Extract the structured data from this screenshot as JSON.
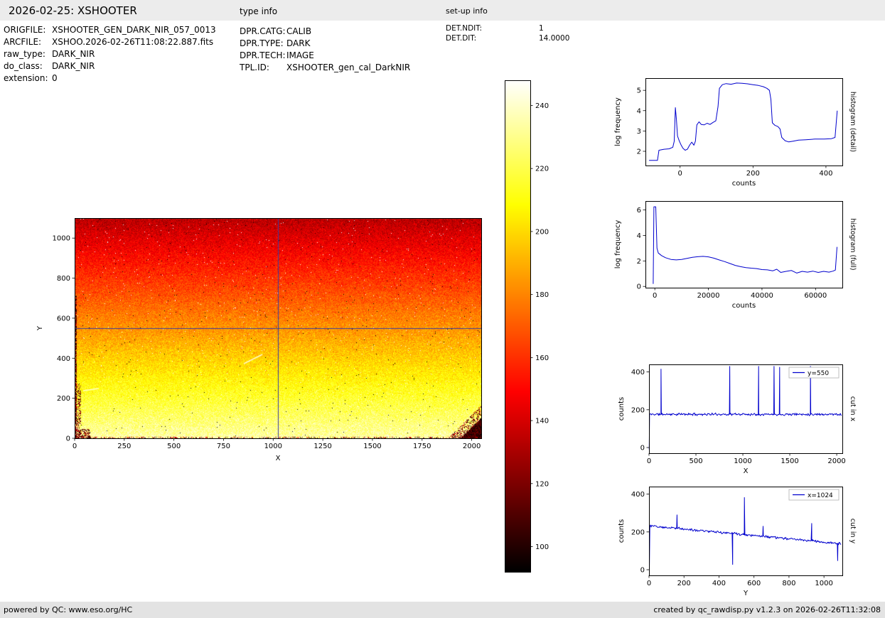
{
  "header": {
    "title": "2026-02-25: XSHOOTER",
    "type_info_label": "type info",
    "setup_info_label": "set-up info"
  },
  "file_info": {
    "rows": [
      {
        "label": "ORIGFILE:",
        "value": "XSHOOTER_GEN_DARK_NIR_057_0013"
      },
      {
        "label": "ARCFILE:",
        "value": "XSHOO.2026-02-26T11:08:22.887.fits"
      },
      {
        "label": "raw_type:",
        "value": "DARK_NIR"
      },
      {
        "label": "do_class:",
        "value": "DARK_NIR"
      },
      {
        "label": "extension:",
        "value": "0"
      }
    ]
  },
  "type_info": {
    "rows": [
      {
        "label": "DPR.CATG:",
        "value": "CALIB"
      },
      {
        "label": "DPR.TYPE:",
        "value": "DARK"
      },
      {
        "label": "DPR.TECH:",
        "value": "IMAGE"
      },
      {
        "label": "TPL.ID:",
        "value": "XSHOOTER_gen_cal_DarkNIR"
      }
    ]
  },
  "setup_info": {
    "rows": [
      {
        "label": "DET.NDIT:",
        "value": "1"
      },
      {
        "label": "DET.DIT:",
        "value": "14.0000"
      }
    ]
  },
  "footer": {
    "left": "powered by QC: www.eso.org/HC",
    "right": "created by qc_rawdisp.py v1.2.3 on 2026-02-26T11:32:08"
  },
  "style": {
    "line_color": "#0000cd",
    "crosshair_color": "#3a3a9e",
    "axis_color": "#000000",
    "colormap": "hot"
  },
  "chart_data": [
    {
      "id": "raw_image",
      "type": "heatmap",
      "xlabel": "X",
      "ylabel": "Y",
      "xlim": [
        0,
        2048
      ],
      "ylim": [
        0,
        1100
      ],
      "xticks": [
        0,
        250,
        500,
        750,
        1000,
        1250,
        1500,
        1750,
        2000
      ],
      "yticks": [
        0,
        200,
        400,
        600,
        800,
        1000
      ],
      "vmin": 92,
      "vmax": 248,
      "value_top": 133,
      "value_bottom": 234,
      "noise_sigma": 7,
      "crosshair": {
        "x": 1024,
        "y": 550
      },
      "colorbar": {
        "ticks": [
          100,
          120,
          140,
          160,
          180,
          200,
          220,
          240
        ]
      },
      "ylabel_off": 46,
      "xlabel_off": 31
    },
    {
      "id": "hist_detail",
      "type": "line",
      "right_label": "histogram (detail)",
      "xlabel": "counts",
      "ylabel": "log frequency",
      "xlim": [
        -95,
        445
      ],
      "ylim": [
        1.3,
        5.6
      ],
      "xticks": [
        0,
        200,
        400
      ],
      "yticks": [
        2,
        3,
        4,
        5
      ],
      "points": [
        [
          -85,
          1.55
        ],
        [
          -62,
          1.55
        ],
        [
          -58,
          2.05
        ],
        [
          -44,
          2.1
        ],
        [
          -30,
          2.12
        ],
        [
          -20,
          2.2
        ],
        [
          -16,
          2.5
        ],
        [
          -13,
          4.15
        ],
        [
          -10,
          3.55
        ],
        [
          -7,
          2.75
        ],
        [
          -2,
          2.5
        ],
        [
          3,
          2.3
        ],
        [
          8,
          2.15
        ],
        [
          14,
          2.05
        ],
        [
          20,
          2.1
        ],
        [
          26,
          2.3
        ],
        [
          32,
          2.45
        ],
        [
          38,
          2.3
        ],
        [
          42,
          2.5
        ],
        [
          46,
          3.3
        ],
        [
          52,
          3.45
        ],
        [
          58,
          3.32
        ],
        [
          66,
          3.3
        ],
        [
          74,
          3.38
        ],
        [
          82,
          3.32
        ],
        [
          90,
          3.42
        ],
        [
          98,
          3.5
        ],
        [
          104,
          4.2
        ],
        [
          108,
          5.1
        ],
        [
          116,
          5.28
        ],
        [
          126,
          5.33
        ],
        [
          140,
          5.3
        ],
        [
          155,
          5.36
        ],
        [
          170,
          5.35
        ],
        [
          185,
          5.32
        ],
        [
          200,
          5.28
        ],
        [
          215,
          5.24
        ],
        [
          228,
          5.18
        ],
        [
          238,
          5.1
        ],
        [
          245,
          5.0
        ],
        [
          249,
          4.55
        ],
        [
          253,
          3.4
        ],
        [
          260,
          3.28
        ],
        [
          268,
          3.22
        ],
        [
          274,
          3.1
        ],
        [
          279,
          2.68
        ],
        [
          288,
          2.52
        ],
        [
          298,
          2.46
        ],
        [
          310,
          2.5
        ],
        [
          325,
          2.55
        ],
        [
          345,
          2.57
        ],
        [
          370,
          2.6
        ],
        [
          395,
          2.6
        ],
        [
          415,
          2.62
        ],
        [
          425,
          2.68
        ],
        [
          431,
          4.0
        ]
      ]
    },
    {
      "id": "hist_full",
      "type": "line",
      "right_label": "histogram (full)",
      "xlabel": "counts",
      "ylabel": "log frequency",
      "xlim": [
        -3500,
        70000
      ],
      "ylim": [
        -0.1,
        6.7
      ],
      "xticks": [
        0,
        20000,
        40000,
        60000
      ],
      "yticks": [
        0,
        2,
        4,
        6
      ],
      "points": [
        [
          -600,
          0.2
        ],
        [
          -350,
          6.25
        ],
        [
          350,
          6.25
        ],
        [
          800,
          3.0
        ],
        [
          1300,
          2.62
        ],
        [
          2500,
          2.42
        ],
        [
          4000,
          2.25
        ],
        [
          6000,
          2.12
        ],
        [
          8000,
          2.08
        ],
        [
          10000,
          2.12
        ],
        [
          12000,
          2.2
        ],
        [
          14000,
          2.28
        ],
        [
          16000,
          2.33
        ],
        [
          18000,
          2.36
        ],
        [
          20000,
          2.32
        ],
        [
          22000,
          2.22
        ],
        [
          24000,
          2.08
        ],
        [
          26000,
          1.95
        ],
        [
          28000,
          1.8
        ],
        [
          30000,
          1.65
        ],
        [
          32000,
          1.55
        ],
        [
          34000,
          1.48
        ],
        [
          36000,
          1.43
        ],
        [
          38000,
          1.4
        ],
        [
          40000,
          1.32
        ],
        [
          42000,
          1.3
        ],
        [
          44000,
          1.22
        ],
        [
          45500,
          1.35
        ],
        [
          47000,
          1.1
        ],
        [
          49000,
          1.18
        ],
        [
          51000,
          1.25
        ],
        [
          53000,
          1.05
        ],
        [
          55000,
          1.18
        ],
        [
          57000,
          1.12
        ],
        [
          59000,
          1.2
        ],
        [
          61000,
          1.1
        ],
        [
          63000,
          1.18
        ],
        [
          65000,
          1.12
        ],
        [
          66500,
          1.2
        ],
        [
          67400,
          1.28
        ],
        [
          68000,
          3.1
        ]
      ]
    },
    {
      "id": "cut_x",
      "type": "line",
      "right_label": "cut in x",
      "xlabel": "X",
      "ylabel": "counts",
      "legend": "y=550",
      "xlim": [
        0,
        2060
      ],
      "ylim": [
        -30,
        440
      ],
      "xticks": [
        0,
        500,
        1000,
        1500,
        2000
      ],
      "yticks": [
        0,
        200,
        400
      ],
      "seed": 11,
      "edge": [
        [
          2,
          -10
        ]
      ],
      "baseline": {
        "x0": 6,
        "x1": 2052,
        "y": 176,
        "noise": 8,
        "n": 320
      },
      "spikes": [
        [
          128,
          415
        ],
        [
          860,
          430
        ],
        [
          1168,
          430
        ],
        [
          1332,
          430
        ],
        [
          1392,
          425
        ],
        [
          1720,
          430
        ]
      ]
    },
    {
      "id": "cut_y",
      "type": "line",
      "right_label": "cut in y",
      "xlabel": "Y",
      "ylabel": "counts",
      "legend": "x=1024",
      "xlim": [
        0,
        1105
      ],
      "ylim": [
        -30,
        440
      ],
      "xticks": [
        0,
        200,
        400,
        600,
        800,
        1000
      ],
      "yticks": [
        0,
        200,
        400
      ],
      "seed": 12,
      "edge": [
        [
          2,
          -5
        ]
      ],
      "baseline": {
        "x0": 5,
        "x1": 1098,
        "y_start": 233,
        "y_end": 138,
        "noise": 8,
        "n": 300
      },
      "spikes": [
        [
          160,
          290
        ],
        [
          478,
          28
        ],
        [
          545,
          382
        ],
        [
          652,
          230
        ],
        [
          930,
          245
        ],
        [
          1078,
          48
        ]
      ]
    }
  ]
}
